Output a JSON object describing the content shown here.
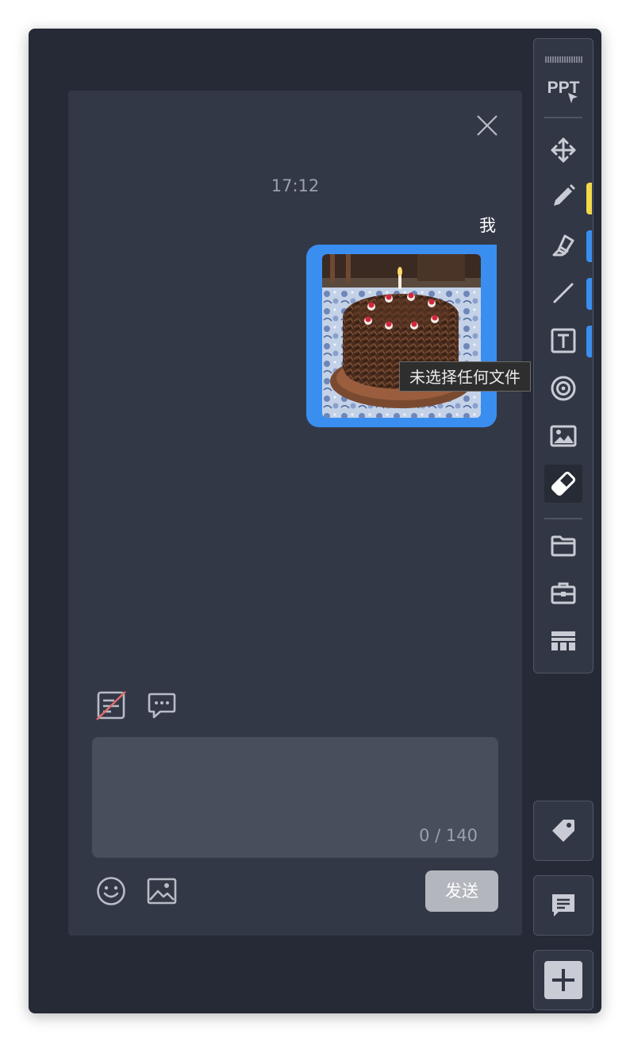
{
  "chat": {
    "timestamp": "17:12",
    "sender": "我",
    "tooltip": "未选择任何文件",
    "input_placeholder": "",
    "input_value": "",
    "counter": "0 / 140",
    "send_label": "发送"
  },
  "toolbar": {
    "ppt_label": "PPT",
    "tools": [
      {
        "name": "move",
        "icon": "move-arrows-icon"
      },
      {
        "name": "pen",
        "icon": "pencil-icon",
        "swatch": "#f2d94a"
      },
      {
        "name": "highlighter",
        "icon": "highlighter-icon",
        "swatch": "#3a8ef0"
      },
      {
        "name": "line",
        "icon": "line-icon",
        "swatch": "#3a8ef0"
      },
      {
        "name": "text",
        "icon": "text-box-icon",
        "swatch": "#3a8ef0"
      },
      {
        "name": "laser",
        "icon": "target-icon"
      },
      {
        "name": "image",
        "icon": "image-icon"
      },
      {
        "name": "eraser",
        "icon": "eraser-icon",
        "active": true
      },
      {
        "name": "files",
        "icon": "folder-icon"
      },
      {
        "name": "toolbox",
        "icon": "toolbox-icon"
      },
      {
        "name": "table",
        "icon": "table-icon"
      }
    ]
  },
  "side_buttons": [
    {
      "name": "tag",
      "icon": "tag-icon"
    },
    {
      "name": "chat",
      "icon": "chat-icon"
    },
    {
      "name": "add",
      "icon": "plus-icon"
    }
  ],
  "colors": {
    "background": "#252a36",
    "panel": "#333846",
    "bubble": "#3a8ef0",
    "pen_swatch": "#f2d94a",
    "send_button": "#b3b6bd"
  }
}
